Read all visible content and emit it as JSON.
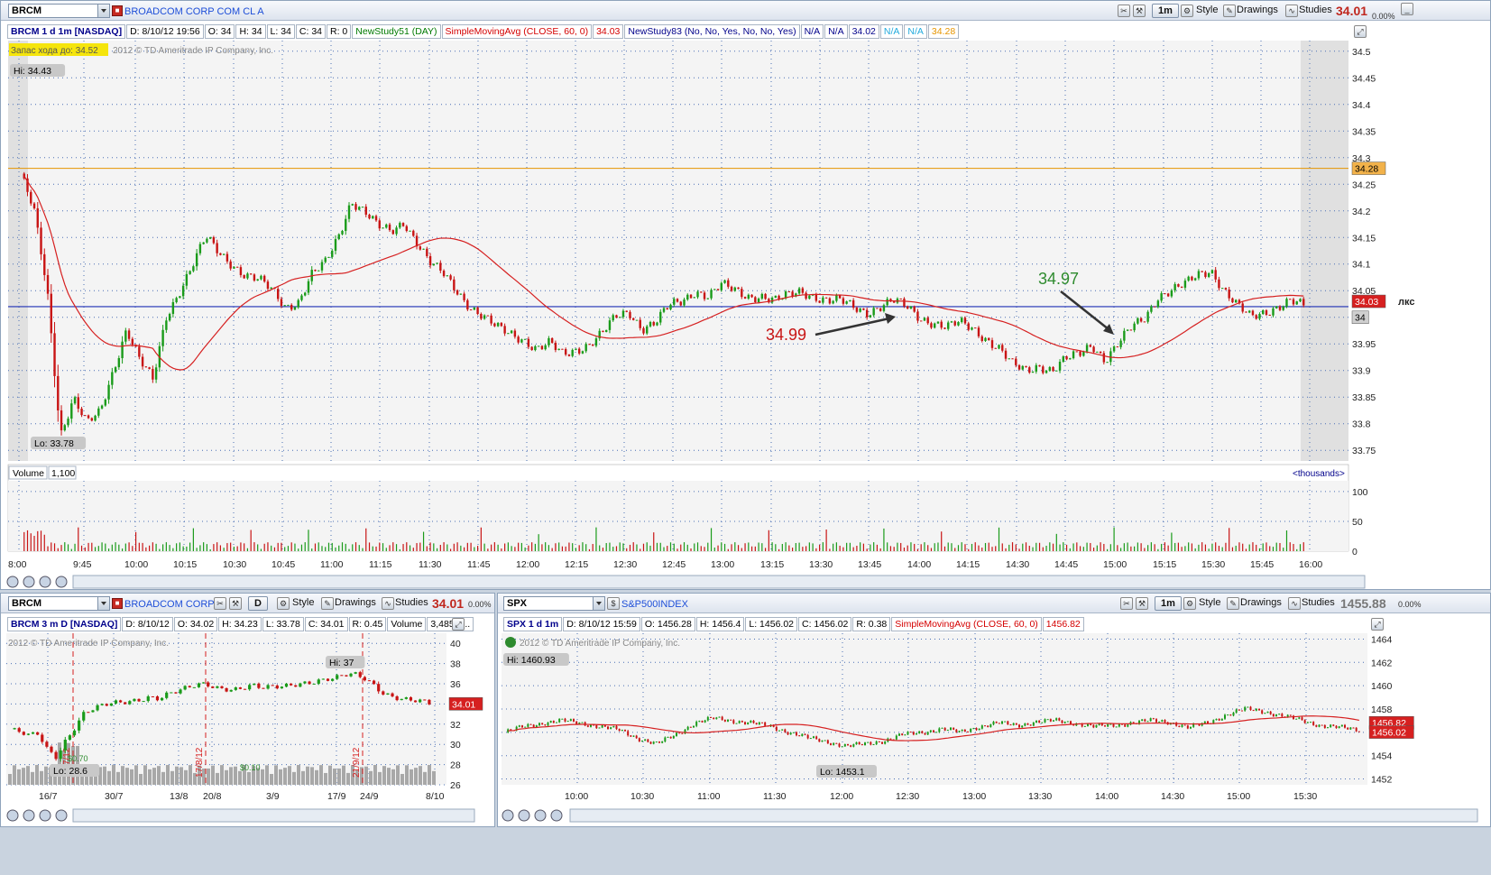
{
  "main": {
    "symbol": "BRCM",
    "company": "BROADCOM CORP COM CL A",
    "toolbar": {
      "period": "1m",
      "style": "Style",
      "drawings": "Drawings",
      "studies": "Studies"
    },
    "last": "34.01",
    "change": "0.00%",
    "info": [
      "BRCM 1 d 1m [NASDAQ]",
      "D: 8/10/12 19:56",
      "O: 34",
      "H: 34",
      "L: 34",
      "C: 34",
      "R: 0",
      "NewStudy51 (DAY)",
      "SimpleMovingAvg (CLOSE, 60, 0)",
      "34.03",
      "NewStudy83 (No, No, Yes, No, No, Yes)",
      "N/A",
      "N/A",
      "34.02",
      "N/A",
      "N/A",
      "34.28"
    ],
    "info_colors": [
      "#00008b",
      "#000",
      "#000",
      "#000",
      "#000",
      "#000",
      "#000",
      "#007a00",
      "#d40000",
      "#d40000",
      "#00008b",
      "#00008b",
      "#00008b",
      "#00008b",
      "#22aadd",
      "#22aadd",
      "#e69500"
    ],
    "reserve_label": "Запас хода до: 34.52",
    "copyright": "2012 © TD Ameritrade IP Company, Inc.",
    "volume_label": "Volume",
    "volume_value": "1,100",
    "thousands": "<thousands>",
    "annot_left": "34.99",
    "annot_right": "34.97",
    "hi_label": "Hi: 34.43",
    "lo_label": "Lo: 33.78",
    "price_tag_sma": "34.03",
    "price_tag_orange": "34.28",
    "price_tag_last": "34",
    "side_text": "лкс"
  },
  "left": {
    "symbol": "BRCM",
    "company": "BROADCOM CORP...",
    "period": "D",
    "style": "Style",
    "drawings": "Drawings",
    "studies": "Studies",
    "last": "34.01",
    "change": "0.00%",
    "info": [
      "BRCM 3 m D [NASDAQ]",
      "D: 8/10/12",
      "O: 34.02",
      "H: 34.23",
      "L: 33.78",
      "C: 34.01",
      "R: 0.45",
      "Volume",
      "3,485,5..."
    ],
    "copyright": "2012 © TD Ameritrade IP Company, Inc.",
    "hi_label": "Hi: 37",
    "lo_label": "Lo: 28.6",
    "price_tag": "34.01",
    "vlines": [
      "17/7/12",
      "17/8/12",
      "21/9/12"
    ],
    "div1": "$0.70",
    "div2": "$0.10"
  },
  "right": {
    "symbol": "SPX",
    "company": "S&P500INDEX",
    "period": "1m",
    "style": "Style",
    "drawings": "Drawings",
    "studies": "Studies",
    "last": "1455.88",
    "change": "0.00%",
    "info": [
      "SPX 1 d 1m",
      "D: 8/10/12 15:59",
      "O: 1456.28",
      "H: 1456.4",
      "L: 1456.02",
      "C: 1456.02",
      "R: 0.38",
      "SimpleMovingAvg (CLOSE, 60, 0)",
      "1456.82"
    ],
    "info_colors": [
      "#00008b",
      "#000",
      "#000",
      "#000",
      "#000",
      "#000",
      "#000",
      "#d40000",
      "#d40000"
    ],
    "copyright": "2012 © TD Ameritrade IP Company, Inc.",
    "hi_label": "Hi: 1460.93",
    "lo_label": "Lo: 1453.1",
    "tag1": "1456.82",
    "tag2": "1456.02"
  },
  "chart_data": [
    {
      "type": "candlestick",
      "title": "BRCM 1 d 1m [NASDAQ]",
      "x_ticks": [
        "8:00",
        "9:45",
        "10:00",
        "10:15",
        "10:30",
        "10:45",
        "11:00",
        "11:15",
        "11:30",
        "11:45",
        "12:00",
        "12:15",
        "12:30",
        "12:45",
        "13:00",
        "13:15",
        "13:30",
        "13:45",
        "14:00",
        "14:15",
        "14:30",
        "14:45",
        "15:00",
        "15:15",
        "15:30",
        "15:45",
        "16:00"
      ],
      "y_ticks": [
        34.5,
        34.45,
        34.4,
        34.35,
        34.3,
        34.25,
        34.2,
        34.15,
        34.1,
        34.05,
        34,
        33.95,
        33.9,
        33.85,
        33.8,
        33.75
      ],
      "ylim": [
        33.73,
        34.52
      ],
      "close_series": [
        34.27,
        34.2,
        34.05,
        33.78,
        33.85,
        33.8,
        33.82,
        33.9,
        33.98,
        33.92,
        33.88,
        34.0,
        34.05,
        34.1,
        34.15,
        34.12,
        34.1,
        34.08,
        34.07,
        34.05,
        34.02,
        34.03,
        34.08,
        34.1,
        34.15,
        34.22,
        34.2,
        34.17,
        34.16,
        34.18,
        34.14,
        34.1,
        34.08,
        34.05,
        34.02,
        34.0,
        33.98,
        33.97,
        33.96,
        33.94,
        33.95,
        33.93,
        33.94,
        33.95,
        33.97,
        34.0,
        34.01,
        33.98,
        33.99,
        34.02,
        34.03,
        34.05,
        34.04,
        34.06,
        34.05,
        34.04,
        34.04,
        34.03,
        34.04,
        34.05,
        34.04,
        34.03,
        34.03,
        34.02,
        34.01,
        34.02,
        34.03,
        34.02,
        34.0,
        33.99,
        33.98,
        33.99,
        33.98,
        33.96,
        33.94,
        33.91,
        33.9,
        33.91,
        33.9,
        33.92,
        33.93,
        33.95,
        33.92,
        33.95,
        33.98,
        34.0,
        34.04,
        34.05,
        34.06,
        34.08,
        34.09,
        34.05,
        34.02,
        34.0,
        34.01,
        34.02,
        34.03,
        34.02
      ],
      "sma": {
        "name": "SimpleMovingAvg (CLOSE, 60, 0)",
        "last": 34.03
      },
      "hlines": [
        {
          "value": 34.28,
          "color": "#e69500"
        },
        {
          "value": 34.02,
          "color": "#1d2fb5"
        }
      ],
      "annotations": [
        {
          "text": "34.99",
          "color": "#d40000"
        },
        {
          "text": "34.97",
          "color": "#2e8b2e"
        }
      ],
      "hi": 34.43,
      "lo": 33.78
    },
    {
      "type": "bar",
      "title": "Volume",
      "unit": "thousands",
      "y_ticks": [
        0,
        50,
        100
      ]
    },
    {
      "type": "candlestick",
      "title": "BRCM 3 m D [NASDAQ]",
      "x_ticks": [
        "16/7",
        "30/7",
        "13/8",
        "20/8",
        "3/9",
        "17/9",
        "24/9",
        "8/10"
      ],
      "y_ticks": [
        26,
        28,
        30,
        32,
        34,
        36,
        38,
        40
      ],
      "ylim": [
        26,
        41
      ],
      "close_series": [
        31.5,
        31.2,
        30.8,
        31.0,
        29.5,
        28.8,
        30.5,
        31.8,
        33.2,
        33.5,
        33.8,
        34.0,
        34.1,
        34.3,
        34.5,
        34.8,
        34.6,
        35.0,
        35.2,
        35.5,
        35.8,
        36.0,
        35.7,
        35.6,
        35.5,
        35.6,
        35.8,
        35.5,
        35.6,
        35.7,
        35.9,
        36.1,
        36.2,
        36.3,
        36.4,
        36.5,
        36.8,
        36.9,
        36.6,
        36.0,
        35.2,
        34.8,
        34.5,
        34.3,
        34.2,
        34.0
      ],
      "hi": 37,
      "lo": 28.6
    },
    {
      "type": "candlestick",
      "title": "SPX 1 d 1m",
      "x_ticks": [
        "10:00",
        "10:30",
        "11:00",
        "11:30",
        "12:00",
        "12:30",
        "13:00",
        "13:30",
        "14:00",
        "14:30",
        "15:00",
        "15:30"
      ],
      "y_ticks": [
        1452,
        1454,
        1456,
        1458,
        1460,
        1462,
        1464
      ],
      "ylim": [
        1451.5,
        1464.5
      ],
      "close_series": [
        1456.0,
        1456.5,
        1456.8,
        1457.0,
        1456.8,
        1456.5,
        1456.2,
        1455.5,
        1455.0,
        1455.8,
        1456.8,
        1457.2,
        1457.0,
        1456.8,
        1456.5,
        1456.0,
        1455.5,
        1455.2,
        1454.8,
        1455.0,
        1455.3,
        1455.8,
        1456.0,
        1456.3,
        1456.0,
        1456.5,
        1456.8,
        1456.6,
        1456.9,
        1457.0,
        1456.8,
        1456.5,
        1456.6,
        1456.8,
        1457.0,
        1456.9,
        1456.4,
        1456.8,
        1457.5,
        1458.0,
        1457.8,
        1457.4,
        1457.0,
        1456.6,
        1456.4,
        1456.2
      ],
      "sma_last": 1456.82,
      "hi": 1460.93,
      "lo": 1453.1
    }
  ]
}
